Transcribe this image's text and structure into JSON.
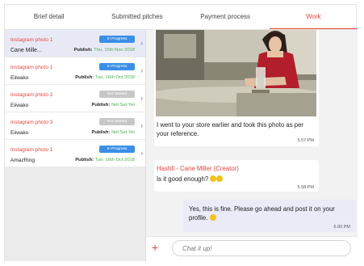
{
  "tabs": [
    {
      "label": "Brief detail"
    },
    {
      "label": "Submitted pitches"
    },
    {
      "label": "Payment process"
    },
    {
      "label": "Work"
    }
  ],
  "active_tab": "Work",
  "posts": [
    {
      "title": "Instagram photo 1",
      "brand": "Cane Mille...",
      "status": "In Progress",
      "publish_label": "Publish:",
      "publish_date": "Thu, 15th Nov 2018"
    },
    {
      "title": "Instagram photo 1",
      "brand": "Eiiwako",
      "status": "In Progress",
      "publish_label": "Publish:",
      "publish_date": "Tue, 16th Oct 2018"
    },
    {
      "title": "Instagram photo 2",
      "brand": "Eiiwako",
      "status": "Not Started",
      "publish_label": "Publish:",
      "publish_date": "Not Set Yet"
    },
    {
      "title": "Instagram photo 3",
      "brand": "Eiiwako",
      "status": "Not Started",
      "publish_label": "Publish:",
      "publish_date": "Not Set Yet"
    },
    {
      "title": "Instagram photo 1",
      "brand": "AmazRing",
      "status": "In Progress",
      "publish_label": "Publish:",
      "publish_date": "Tue, 16th Oct 2018"
    }
  ],
  "chat": {
    "messages": [
      {
        "text": "I went to your store earlier and took this photo as per your reference.",
        "time": "5.57 PM"
      },
      {
        "sender": "Hashfi - Cane Miller (Creator)",
        "text": "Is it good enough?",
        "time": "5.58 PM"
      },
      {
        "text": "Yes, this is fine. Please go ahead and post it on your profile.",
        "time": "6.00 PM"
      }
    ],
    "input_placeholder": "Chat it up!"
  },
  "colors": {
    "accent": "#e9453d",
    "in_progress": "#3b8fe6",
    "not_started": "#c7c7c7",
    "date": "#4aae4d",
    "selected_row": "#e7eaf6"
  },
  "icons": {
    "add": "plus-icon",
    "chevron": "chevron-right-icon"
  }
}
